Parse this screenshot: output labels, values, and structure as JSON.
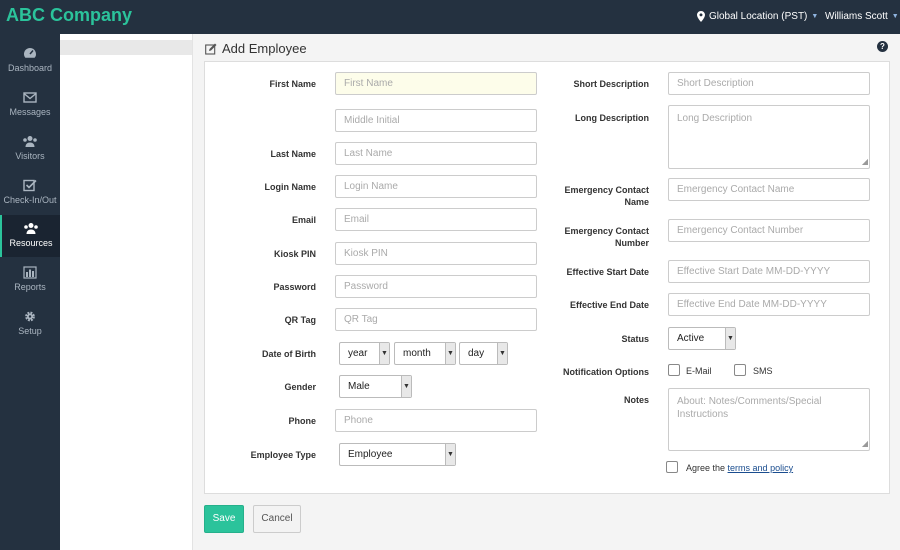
{
  "app": {
    "brand": "ABC Company"
  },
  "header": {
    "location": "Global Location (PST)",
    "user": "Williams Scott"
  },
  "sidebar": {
    "items": [
      {
        "label": "Dashboard",
        "icon": "dashboard-icon"
      },
      {
        "label": "Messages",
        "icon": "envelope-icon"
      },
      {
        "label": "Visitors",
        "icon": "users-icon"
      },
      {
        "label": "Check-In/Out",
        "icon": "checkbox-icon"
      },
      {
        "label": "Resources",
        "icon": "users-icon",
        "active": true
      },
      {
        "label": "Reports",
        "icon": "bar-chart-icon"
      },
      {
        "label": "Setup",
        "icon": "gear-icon"
      }
    ]
  },
  "page": {
    "title": "Add Employee"
  },
  "form": {
    "first_name": {
      "label": "First Name",
      "placeholder": "First Name"
    },
    "middle_initial": {
      "placeholder": "Middle Initial"
    },
    "last_name": {
      "label": "Last Name",
      "placeholder": "Last Name"
    },
    "login_name": {
      "label": "Login Name",
      "placeholder": "Login Name"
    },
    "email": {
      "label": "Email",
      "placeholder": "Email"
    },
    "kiosk_pin": {
      "label": "Kiosk PIN",
      "placeholder": "Kiosk PIN"
    },
    "password": {
      "label": "Password",
      "placeholder": "Password"
    },
    "qr_tag": {
      "label": "QR Tag",
      "placeholder": "QR Tag"
    },
    "dob": {
      "label": "Date of Birth",
      "year": "year",
      "month": "month",
      "day": "day"
    },
    "gender": {
      "label": "Gender",
      "value": "Male"
    },
    "phone": {
      "label": "Phone",
      "placeholder": "Phone"
    },
    "employee_type": {
      "label": "Employee Type",
      "value": "Employee"
    },
    "short_description": {
      "label": "Short Description",
      "placeholder": "Short Description"
    },
    "long_description": {
      "label": "Long Description",
      "placeholder": "Long Description"
    },
    "emergency_name": {
      "label_line1": "Emergency Contact",
      "label_line2": "Name",
      "placeholder": "Emergency Contact Name"
    },
    "emergency_number": {
      "label_line1": "Emergency Contact",
      "label_line2": "Number",
      "placeholder": "Emergency Contact Number"
    },
    "start_date": {
      "label": "Effective Start Date",
      "placeholder": "Effective Start Date MM-DD-YYYY"
    },
    "end_date": {
      "label": "Effective End Date",
      "placeholder": "Effective End Date MM-DD-YYYY"
    },
    "status": {
      "label": "Status",
      "value": "Active"
    },
    "notification": {
      "label": "Notification Options",
      "email": "E-Mail",
      "sms": "SMS"
    },
    "notes": {
      "label": "Notes",
      "placeholder": "About: Notes/Comments/Special Instructions"
    },
    "agree": {
      "text": "Agree the",
      "link": "terms and policy"
    }
  },
  "actions": {
    "save": "Save",
    "cancel": "Cancel"
  },
  "colors": {
    "accent": "#2bc39b",
    "nav_bg": "#243140"
  }
}
